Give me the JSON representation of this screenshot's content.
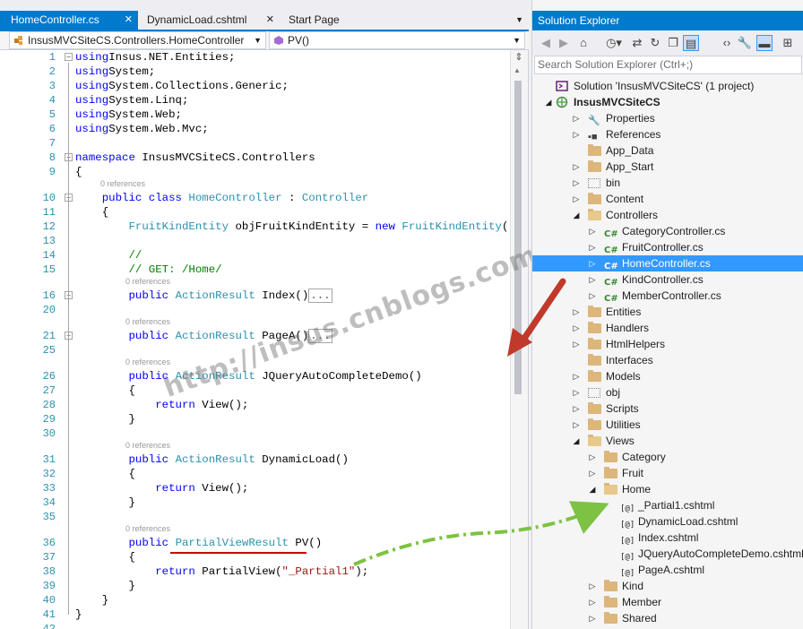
{
  "tabs": [
    {
      "label": "HomeController.cs",
      "active": true,
      "close": "✕"
    },
    {
      "label": "DynamicLoad.cshtml",
      "active": false,
      "close": "✕"
    },
    {
      "label": "Start Page",
      "active": false,
      "close": ""
    }
  ],
  "nav": {
    "class_path": "InsusMVCSiteCS.Controllers.HomeController",
    "member": "PV()"
  },
  "codelens": "0 references",
  "code_lines": [
    {
      "n": "1",
      "tokens": [
        [
          "kw",
          "using"
        ],
        [
          "",
          "Insus.NET.Entities;"
        ]
      ]
    },
    {
      "n": "2",
      "tokens": [
        [
          "kw",
          "using"
        ],
        [
          "",
          "System;"
        ]
      ]
    },
    {
      "n": "3",
      "tokens": [
        [
          "kw",
          "using"
        ],
        [
          "",
          "System.Collections.Generic;"
        ]
      ]
    },
    {
      "n": "4",
      "tokens": [
        [
          "kw",
          "using"
        ],
        [
          "",
          "System.Linq;"
        ]
      ]
    },
    {
      "n": "5",
      "tokens": [
        [
          "kw",
          "using"
        ],
        [
          "",
          "System.Web;"
        ]
      ]
    },
    {
      "n": "6",
      "tokens": [
        [
          "kw",
          "using"
        ],
        [
          "",
          "System.Web.Mvc;"
        ]
      ]
    },
    {
      "n": "7",
      "tokens": []
    },
    {
      "n": "8",
      "tokens": [
        [
          "kw",
          "namespace"
        ],
        [
          "",
          " InsusMVCSiteCS.Controllers"
        ]
      ]
    },
    {
      "n": "9",
      "tokens": [
        [
          "",
          "{"
        ]
      ]
    },
    {
      "n": "10",
      "tokens": [
        [
          "",
          "    "
        ],
        [
          "kw",
          "public class "
        ],
        [
          "ty",
          "HomeController"
        ],
        [
          "",
          " : "
        ],
        [
          "ty",
          "Controller"
        ]
      ]
    },
    {
      "n": "11",
      "tokens": [
        [
          "",
          "    {"
        ]
      ]
    },
    {
      "n": "12",
      "tokens": [
        [
          "",
          "        "
        ],
        [
          "ty",
          "FruitKindEntity"
        ],
        [
          "",
          " objFruitKindEntity = "
        ],
        [
          "kw",
          "new "
        ],
        [
          "ty",
          "FruitKindEntity"
        ],
        [
          "",
          "();"
        ]
      ]
    },
    {
      "n": "13",
      "tokens": []
    },
    {
      "n": "14",
      "tokens": [
        [
          "",
          "        "
        ],
        [
          "cm",
          "//"
        ]
      ]
    },
    {
      "n": "15",
      "tokens": [
        [
          "",
          "        "
        ],
        [
          "cm",
          "// GET: /Home/"
        ]
      ]
    },
    {
      "n": "16",
      "tokens": [
        [
          "",
          "        "
        ],
        [
          "kw",
          "public "
        ],
        [
          "ty",
          "ActionResult"
        ],
        [
          "",
          " Index()"
        ],
        [
          "coll",
          "..."
        ]
      ]
    },
    {
      "n": "20",
      "tokens": []
    },
    {
      "n": "21",
      "tokens": [
        [
          "",
          "        "
        ],
        [
          "kw",
          "public "
        ],
        [
          "ty",
          "ActionResult"
        ],
        [
          "",
          " PageA()"
        ],
        [
          "coll",
          "..."
        ]
      ]
    },
    {
      "n": "25",
      "tokens": []
    },
    {
      "n": "26",
      "tokens": [
        [
          "",
          "        "
        ],
        [
          "kw",
          "public "
        ],
        [
          "ty",
          "ActionResult"
        ],
        [
          "",
          " JQueryAutoCompleteDemo()"
        ]
      ]
    },
    {
      "n": "27",
      "tokens": [
        [
          "",
          "        {"
        ]
      ]
    },
    {
      "n": "28",
      "tokens": [
        [
          "",
          "            "
        ],
        [
          "kw",
          "return "
        ],
        [
          "",
          "View();"
        ]
      ]
    },
    {
      "n": "29",
      "tokens": [
        [
          "",
          "        }"
        ]
      ]
    },
    {
      "n": "30",
      "tokens": []
    },
    {
      "n": "31",
      "tokens": [
        [
          "",
          "        "
        ],
        [
          "kw",
          "public "
        ],
        [
          "ty",
          "ActionResult"
        ],
        [
          "",
          " DynamicLoad()"
        ]
      ]
    },
    {
      "n": "32",
      "tokens": [
        [
          "",
          "        {"
        ]
      ]
    },
    {
      "n": "33",
      "tokens": [
        [
          "",
          "            "
        ],
        [
          "kw",
          "return "
        ],
        [
          "",
          "View();"
        ]
      ]
    },
    {
      "n": "34",
      "tokens": [
        [
          "",
          "        }"
        ]
      ]
    },
    {
      "n": "35",
      "tokens": []
    },
    {
      "n": "36",
      "tokens": [
        [
          "",
          "        "
        ],
        [
          "kw",
          "public "
        ],
        [
          "ty",
          "PartialViewResult"
        ],
        [
          "",
          " PV()"
        ]
      ]
    },
    {
      "n": "37",
      "tokens": [
        [
          "",
          "        {"
        ]
      ]
    },
    {
      "n": "38",
      "tokens": [
        [
          "",
          "            "
        ],
        [
          "kw",
          "return "
        ],
        [
          "",
          "PartialView("
        ],
        [
          "st",
          "\"_Partial1\""
        ],
        [
          "",
          ");"
        ]
      ]
    },
    {
      "n": "39",
      "tokens": [
        [
          "",
          "        }"
        ]
      ]
    },
    {
      "n": "40",
      "tokens": [
        [
          "",
          "    }"
        ]
      ]
    },
    {
      "n": "41",
      "tokens": [
        [
          "",
          "}"
        ]
      ]
    },
    {
      "n": "42",
      "tokens": []
    }
  ],
  "watermark": "http://insus.cnblogs.com",
  "solution_explorer": {
    "title": "Solution Explorer",
    "search_placeholder": "Search Solution Explorer (Ctrl+;)",
    "items": [
      {
        "label": "Solution 'InsusMVCSiteCS' (1 project)",
        "level": 0,
        "icon": "solution-icon",
        "exp": ""
      },
      {
        "label": "InsusMVCSiteCS",
        "level": 0,
        "icon": "web-project-icon",
        "exp": "open",
        "bold": true
      },
      {
        "label": "Properties",
        "level": 1,
        "icon": "wrench-icon",
        "exp": "closed"
      },
      {
        "label": "References",
        "level": 1,
        "icon": "references-icon",
        "exp": "closed"
      },
      {
        "label": "App_Data",
        "level": 1,
        "icon": "folder-icon",
        "exp": ""
      },
      {
        "label": "App_Start",
        "level": 1,
        "icon": "folder-icon",
        "exp": "closed"
      },
      {
        "label": "bin",
        "level": 1,
        "icon": "hidden-folder-icon",
        "exp": "closed"
      },
      {
        "label": "Content",
        "level": 1,
        "icon": "folder-icon",
        "exp": "closed"
      },
      {
        "label": "Controllers",
        "level": 1,
        "icon": "folder-open-icon",
        "exp": "open"
      },
      {
        "label": "CategoryController.cs",
        "level": 2,
        "icon": "csharp-file-icon",
        "exp": "closed"
      },
      {
        "label": "FruitController.cs",
        "level": 2,
        "icon": "csharp-file-icon",
        "exp": "closed"
      },
      {
        "label": "HomeController.cs",
        "level": 2,
        "icon": "csharp-file-icon",
        "exp": "closed",
        "selected": true
      },
      {
        "label": "KindController.cs",
        "level": 2,
        "icon": "csharp-file-icon",
        "exp": "closed"
      },
      {
        "label": "MemberController.cs",
        "level": 2,
        "icon": "csharp-file-icon",
        "exp": "closed"
      },
      {
        "label": "Entities",
        "level": 1,
        "icon": "folder-icon",
        "exp": "closed"
      },
      {
        "label": "Handlers",
        "level": 1,
        "icon": "folder-icon",
        "exp": "closed"
      },
      {
        "label": "HtmlHelpers",
        "level": 1,
        "icon": "folder-icon",
        "exp": "closed"
      },
      {
        "label": "Interfaces",
        "level": 1,
        "icon": "folder-icon",
        "exp": ""
      },
      {
        "label": "Models",
        "level": 1,
        "icon": "folder-icon",
        "exp": "closed"
      },
      {
        "label": "obj",
        "level": 1,
        "icon": "hidden-folder-icon",
        "exp": "closed"
      },
      {
        "label": "Scripts",
        "level": 1,
        "icon": "folder-icon",
        "exp": "closed"
      },
      {
        "label": "Utilities",
        "level": 1,
        "icon": "folder-icon",
        "exp": "closed"
      },
      {
        "label": "Views",
        "level": 1,
        "icon": "folder-open-icon",
        "exp": "open"
      },
      {
        "label": "Category",
        "level": 2,
        "icon": "folder-icon",
        "exp": "closed"
      },
      {
        "label": "Fruit",
        "level": 2,
        "icon": "folder-icon",
        "exp": "closed"
      },
      {
        "label": "Home",
        "level": 2,
        "icon": "folder-open-icon",
        "exp": "open"
      },
      {
        "label": "_Partial1.cshtml",
        "level": 3,
        "icon": "cshtml-file-icon",
        "exp": ""
      },
      {
        "label": "DynamicLoad.cshtml",
        "level": 3,
        "icon": "cshtml-file-icon",
        "exp": ""
      },
      {
        "label": "Index.cshtml",
        "level": 3,
        "icon": "cshtml-file-icon",
        "exp": ""
      },
      {
        "label": "JQueryAutoCompleteDemo.cshtml",
        "level": 3,
        "icon": "cshtml-file-icon",
        "exp": ""
      },
      {
        "label": "PageA.cshtml",
        "level": 3,
        "icon": "cshtml-file-icon",
        "exp": ""
      },
      {
        "label": "Kind",
        "level": 2,
        "icon": "folder-icon",
        "exp": "closed"
      },
      {
        "label": "Member",
        "level": 2,
        "icon": "folder-icon",
        "exp": "closed"
      },
      {
        "label": "Shared",
        "level": 2,
        "icon": "folder-icon",
        "exp": "closed"
      }
    ]
  },
  "colors": {
    "accent": "#007acc",
    "selection": "#3399ff",
    "keyword": "#0000ff",
    "type": "#2b91af",
    "comment": "#008000",
    "string": "#a31515",
    "annotation_red": "#c0392b",
    "annotation_green": "#7dc243"
  }
}
